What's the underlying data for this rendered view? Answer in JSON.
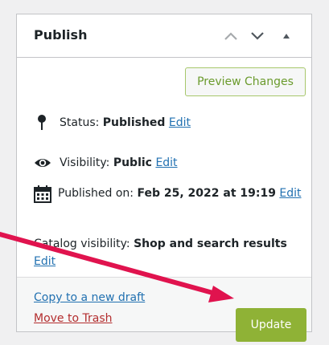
{
  "panel": {
    "title": "Publish",
    "controls": [
      "chevron-up-icon",
      "chevron-down-icon",
      "triangle-up-icon"
    ]
  },
  "preview_button": {
    "label": "Preview Changes"
  },
  "status": {
    "label": "Status:",
    "value": "Published",
    "edit": "Edit"
  },
  "visibility": {
    "label": "Visibility:",
    "value": "Public",
    "edit": "Edit"
  },
  "published_on": {
    "label": "Published on:",
    "value": "Feb 25, 2022 at 19:19",
    "edit": "Edit"
  },
  "catalog_visibility": {
    "label": "Catalog visibility:",
    "value": "Shop and search results",
    "edit": "Edit"
  },
  "footer": {
    "copy_link": "Copy to a new draft",
    "trash_link": "Move to Trash",
    "update_button": "Update"
  },
  "colors": {
    "link": "#2271b1",
    "trash": "#b32d2e",
    "update_bg": "#8fb236",
    "preview_border": "#a7c76b",
    "annotation_arrow": "#e0134e"
  }
}
